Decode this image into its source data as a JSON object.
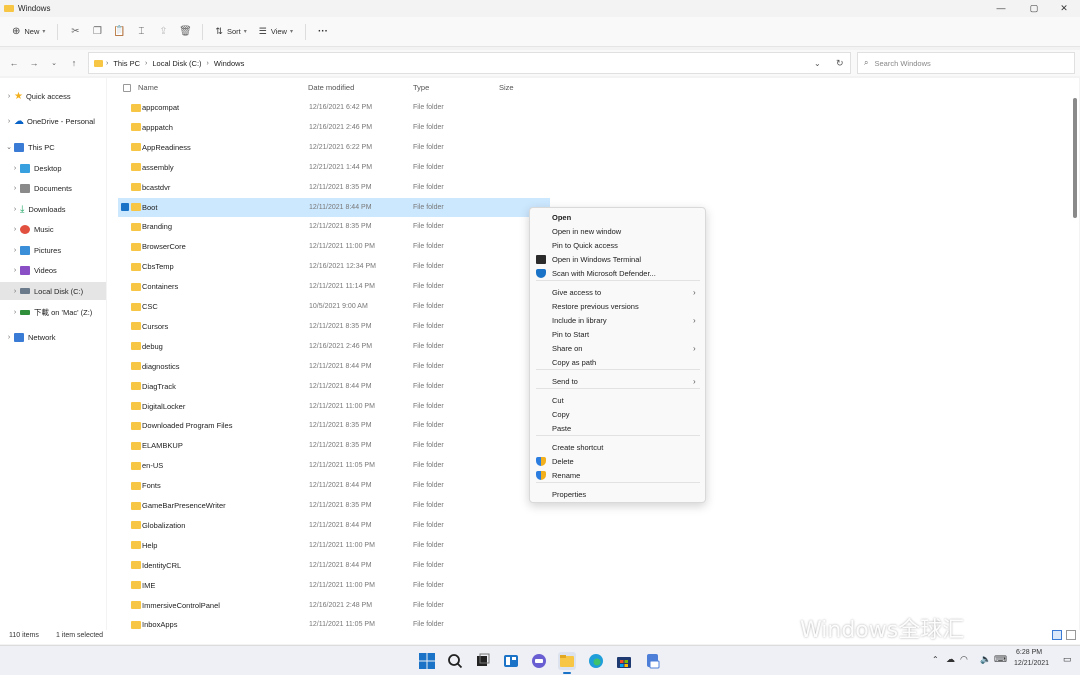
{
  "window": {
    "title": "Windows"
  },
  "toolbar": {
    "new_label": "New",
    "sort_label": "Sort",
    "view_label": "View",
    "more_label": "···"
  },
  "address": {
    "segments": [
      "This PC",
      "Local Disk (C:)",
      "Windows"
    ],
    "search_placeholder": "Search Windows"
  },
  "sidebar": {
    "items": [
      {
        "label": "Quick access",
        "icon": "star-icon",
        "color": "#f2b01e"
      },
      {
        "label": "OneDrive - Personal",
        "icon": "cloud-icon",
        "color": "#0a64c8"
      },
      {
        "label": "This PC",
        "icon": "pc-icon",
        "color": "#3a7bd5"
      },
      {
        "label": "Desktop",
        "icon": "desktop-icon",
        "color": "#39a0e0"
      },
      {
        "label": "Documents",
        "icon": "documents-icon",
        "color": "#8a8a8a"
      },
      {
        "label": "Downloads",
        "icon": "download-icon",
        "color": "#1aa260"
      },
      {
        "label": "Music",
        "icon": "music-icon",
        "color": "#e2503f"
      },
      {
        "label": "Pictures",
        "icon": "pictures-icon",
        "color": "#3b8fd8"
      },
      {
        "label": "Videos",
        "icon": "videos-icon",
        "color": "#8b4fc5"
      },
      {
        "label": "Local Disk (C:)",
        "icon": "disk-icon",
        "color": "#6b7b8c"
      },
      {
        "label": "下載 on 'Mac' (Z:)",
        "icon": "network-drive-icon",
        "color": "#2f8f3a"
      },
      {
        "label": "Network",
        "icon": "network-icon",
        "color": "#3a7bd5"
      }
    ]
  },
  "columns": {
    "name": "Name",
    "date": "Date modified",
    "type": "Type",
    "size": "Size"
  },
  "files": [
    {
      "name": "appcompat",
      "date": "12/16/2021 6:42 PM",
      "type": "File folder"
    },
    {
      "name": "apppatch",
      "date": "12/16/2021 2:46 PM",
      "type": "File folder"
    },
    {
      "name": "AppReadiness",
      "date": "12/21/2021 6:22 PM",
      "type": "File folder"
    },
    {
      "name": "assembly",
      "date": "12/21/2021 1:44 PM",
      "type": "File folder"
    },
    {
      "name": "bcastdvr",
      "date": "12/11/2021 8:35 PM",
      "type": "File folder"
    },
    {
      "name": "Boot",
      "date": "12/11/2021 8:44 PM",
      "type": "File folder"
    },
    {
      "name": "Branding",
      "date": "12/11/2021 8:35 PM",
      "type": "File folder"
    },
    {
      "name": "BrowserCore",
      "date": "12/11/2021 11:00 PM",
      "type": "File folder"
    },
    {
      "name": "CbsTemp",
      "date": "12/16/2021 12:34 PM",
      "type": "File folder"
    },
    {
      "name": "Containers",
      "date": "12/11/2021 11:14 PM",
      "type": "File folder"
    },
    {
      "name": "CSC",
      "date": "10/5/2021 9:00 AM",
      "type": "File folder"
    },
    {
      "name": "Cursors",
      "date": "12/11/2021 8:35 PM",
      "type": "File folder"
    },
    {
      "name": "debug",
      "date": "12/16/2021 2:46 PM",
      "type": "File folder"
    },
    {
      "name": "diagnostics",
      "date": "12/11/2021 8:44 PM",
      "type": "File folder"
    },
    {
      "name": "DiagTrack",
      "date": "12/11/2021 8:44 PM",
      "type": "File folder"
    },
    {
      "name": "DigitalLocker",
      "date": "12/11/2021 11:00 PM",
      "type": "File folder"
    },
    {
      "name": "Downloaded Program Files",
      "date": "12/11/2021 8:35 PM",
      "type": "File folder"
    },
    {
      "name": "ELAMBKUP",
      "date": "12/11/2021 8:35 PM",
      "type": "File folder"
    },
    {
      "name": "en-US",
      "date": "12/11/2021 11:05 PM",
      "type": "File folder"
    },
    {
      "name": "Fonts",
      "date": "12/11/2021 8:44 PM",
      "type": "File folder"
    },
    {
      "name": "GameBarPresenceWriter",
      "date": "12/11/2021 8:35 PM",
      "type": "File folder"
    },
    {
      "name": "Globalization",
      "date": "12/11/2021 8:44 PM",
      "type": "File folder"
    },
    {
      "name": "Help",
      "date": "12/11/2021 11:00 PM",
      "type": "File folder"
    },
    {
      "name": "IdentityCRL",
      "date": "12/11/2021 8:44 PM",
      "type": "File folder"
    },
    {
      "name": "IME",
      "date": "12/11/2021 11:00 PM",
      "type": "File folder"
    },
    {
      "name": "ImmersiveControlPanel",
      "date": "12/16/2021 2:48 PM",
      "type": "File folder"
    },
    {
      "name": "InboxApps",
      "date": "12/11/2021 11:05 PM",
      "type": "File folder"
    }
  ],
  "context_menu": {
    "items": [
      {
        "label": "Open",
        "bold": true
      },
      {
        "label": "Open in new window"
      },
      {
        "label": "Pin to Quick access"
      },
      {
        "label": "Open in Windows Terminal",
        "icon": "terminal-icon"
      },
      {
        "label": "Scan with Microsoft Defender...",
        "icon": "defender-shield-icon"
      },
      {
        "label": "Give access to",
        "submenu": true
      },
      {
        "label": "Restore previous versions"
      },
      {
        "label": "Include in library",
        "submenu": true
      },
      {
        "label": "Pin to Start"
      },
      {
        "label": "Share on",
        "submenu": true
      },
      {
        "label": "Copy as path"
      },
      {
        "label": "Send to",
        "submenu": true
      },
      {
        "label": "Cut"
      },
      {
        "label": "Copy"
      },
      {
        "label": "Paste"
      },
      {
        "label": "Create shortcut"
      },
      {
        "label": "Delete",
        "icon": "uac-shield-icon"
      },
      {
        "label": "Rename",
        "icon": "uac-shield-icon"
      },
      {
        "label": "Properties"
      }
    ]
  },
  "status": {
    "count": "110 items",
    "selected": "1 item selected"
  },
  "taskbar": {
    "time": "6:28 PM",
    "date": "12/21/2021"
  },
  "watermark": "Windows全球汇",
  "colors": {
    "accent": "#1a73c7",
    "selection": "#cce8ff",
    "folder": "#f7c644"
  }
}
